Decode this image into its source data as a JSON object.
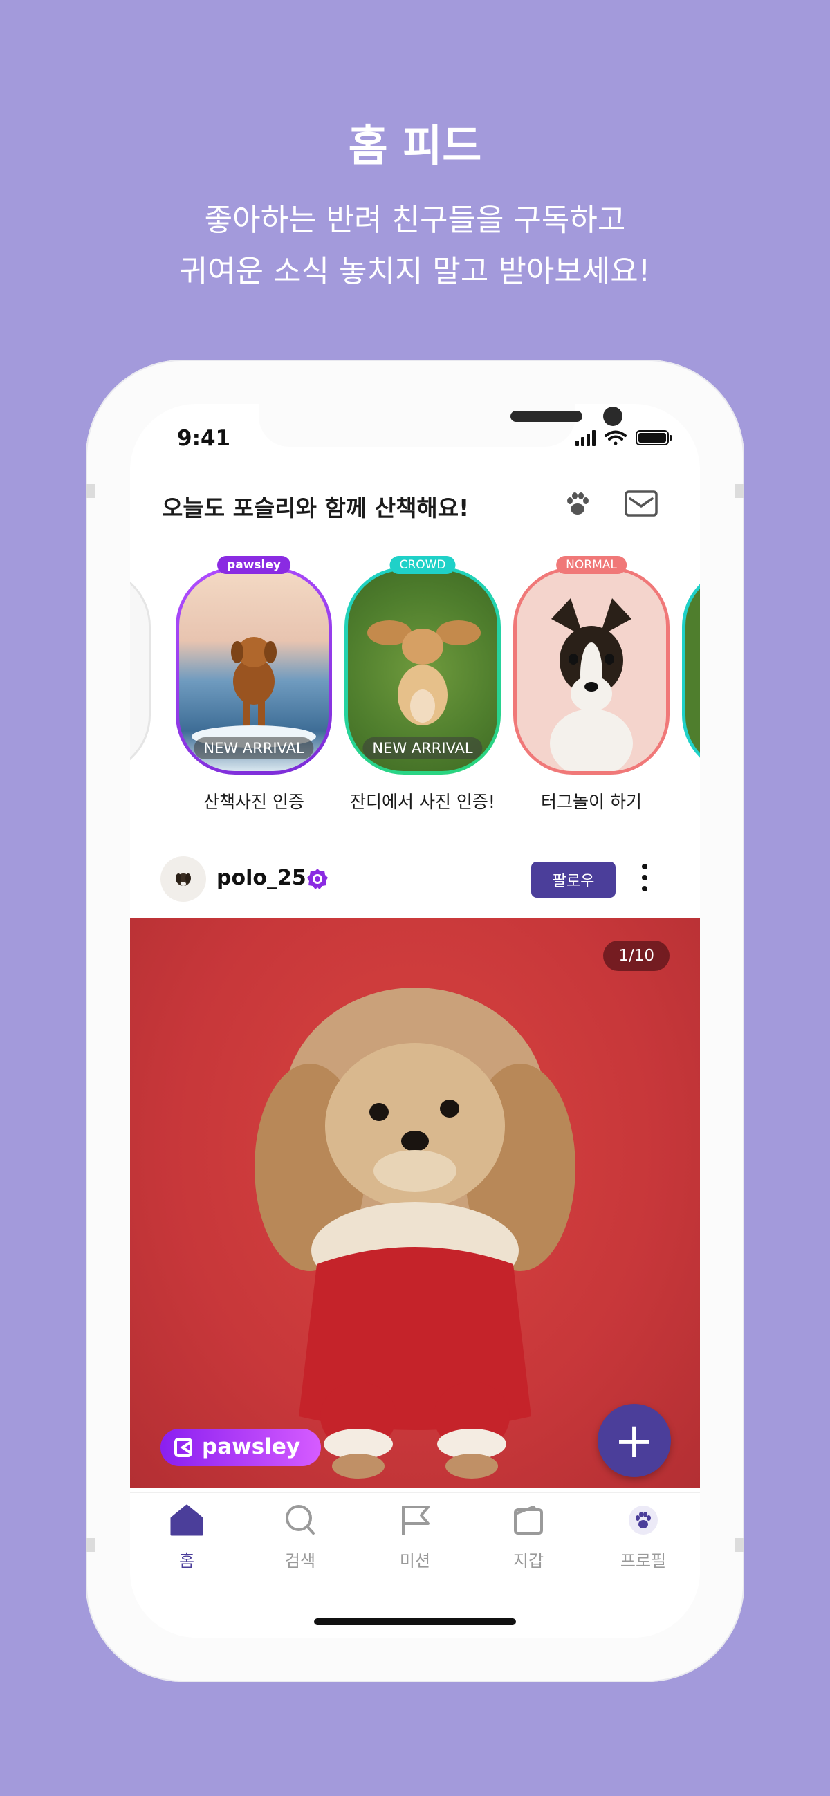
{
  "hero": {
    "title": "홈 피드",
    "subtitle_line1": "좋아하는 반려 친구들을 구독하고",
    "subtitle_line2": "귀여운 소식 놓치지 말고 받아보세요!"
  },
  "status_bar": {
    "time": "9:41"
  },
  "header": {
    "title": "오늘도 포슬리와 함께 산책해요!",
    "icons": [
      "paw-icon",
      "mail-icon"
    ]
  },
  "stories": [
    {
      "label": "|",
      "badge": "",
      "pill": ""
    },
    {
      "label": "산책사진 인증",
      "badge": "pawsley",
      "pill": "NEW ARRIVAL",
      "color": "#8a2be2"
    },
    {
      "label": "잔디에서 사진 인증!",
      "badge": "CROWD",
      "pill": "NEW ARRIVAL",
      "color": "#1fd1c8"
    },
    {
      "label": "터그놀이 하기",
      "badge": "NORMAL",
      "pill": "",
      "color": "#f07878"
    }
  ],
  "post": {
    "username": "polo_25",
    "follow_label": "팔로우",
    "counter": "1/10",
    "brand": "pawsley"
  },
  "fab": {
    "label": "+"
  },
  "nav": [
    {
      "label": "홈",
      "icon": "home-icon",
      "active": true
    },
    {
      "label": "검색",
      "icon": "search-icon",
      "active": false
    },
    {
      "label": "미션",
      "icon": "flag-icon",
      "active": false
    },
    {
      "label": "지갑",
      "icon": "wallet-icon",
      "active": false
    },
    {
      "label": "프로필",
      "icon": "profile-paw-icon",
      "active": false
    }
  ],
  "colors": {
    "background": "#a39adb",
    "accent": "#4b3e9a",
    "pawsley_purple": "#8a2be2",
    "crowd_teal": "#1fd1c8",
    "normal_coral": "#f07878"
  }
}
